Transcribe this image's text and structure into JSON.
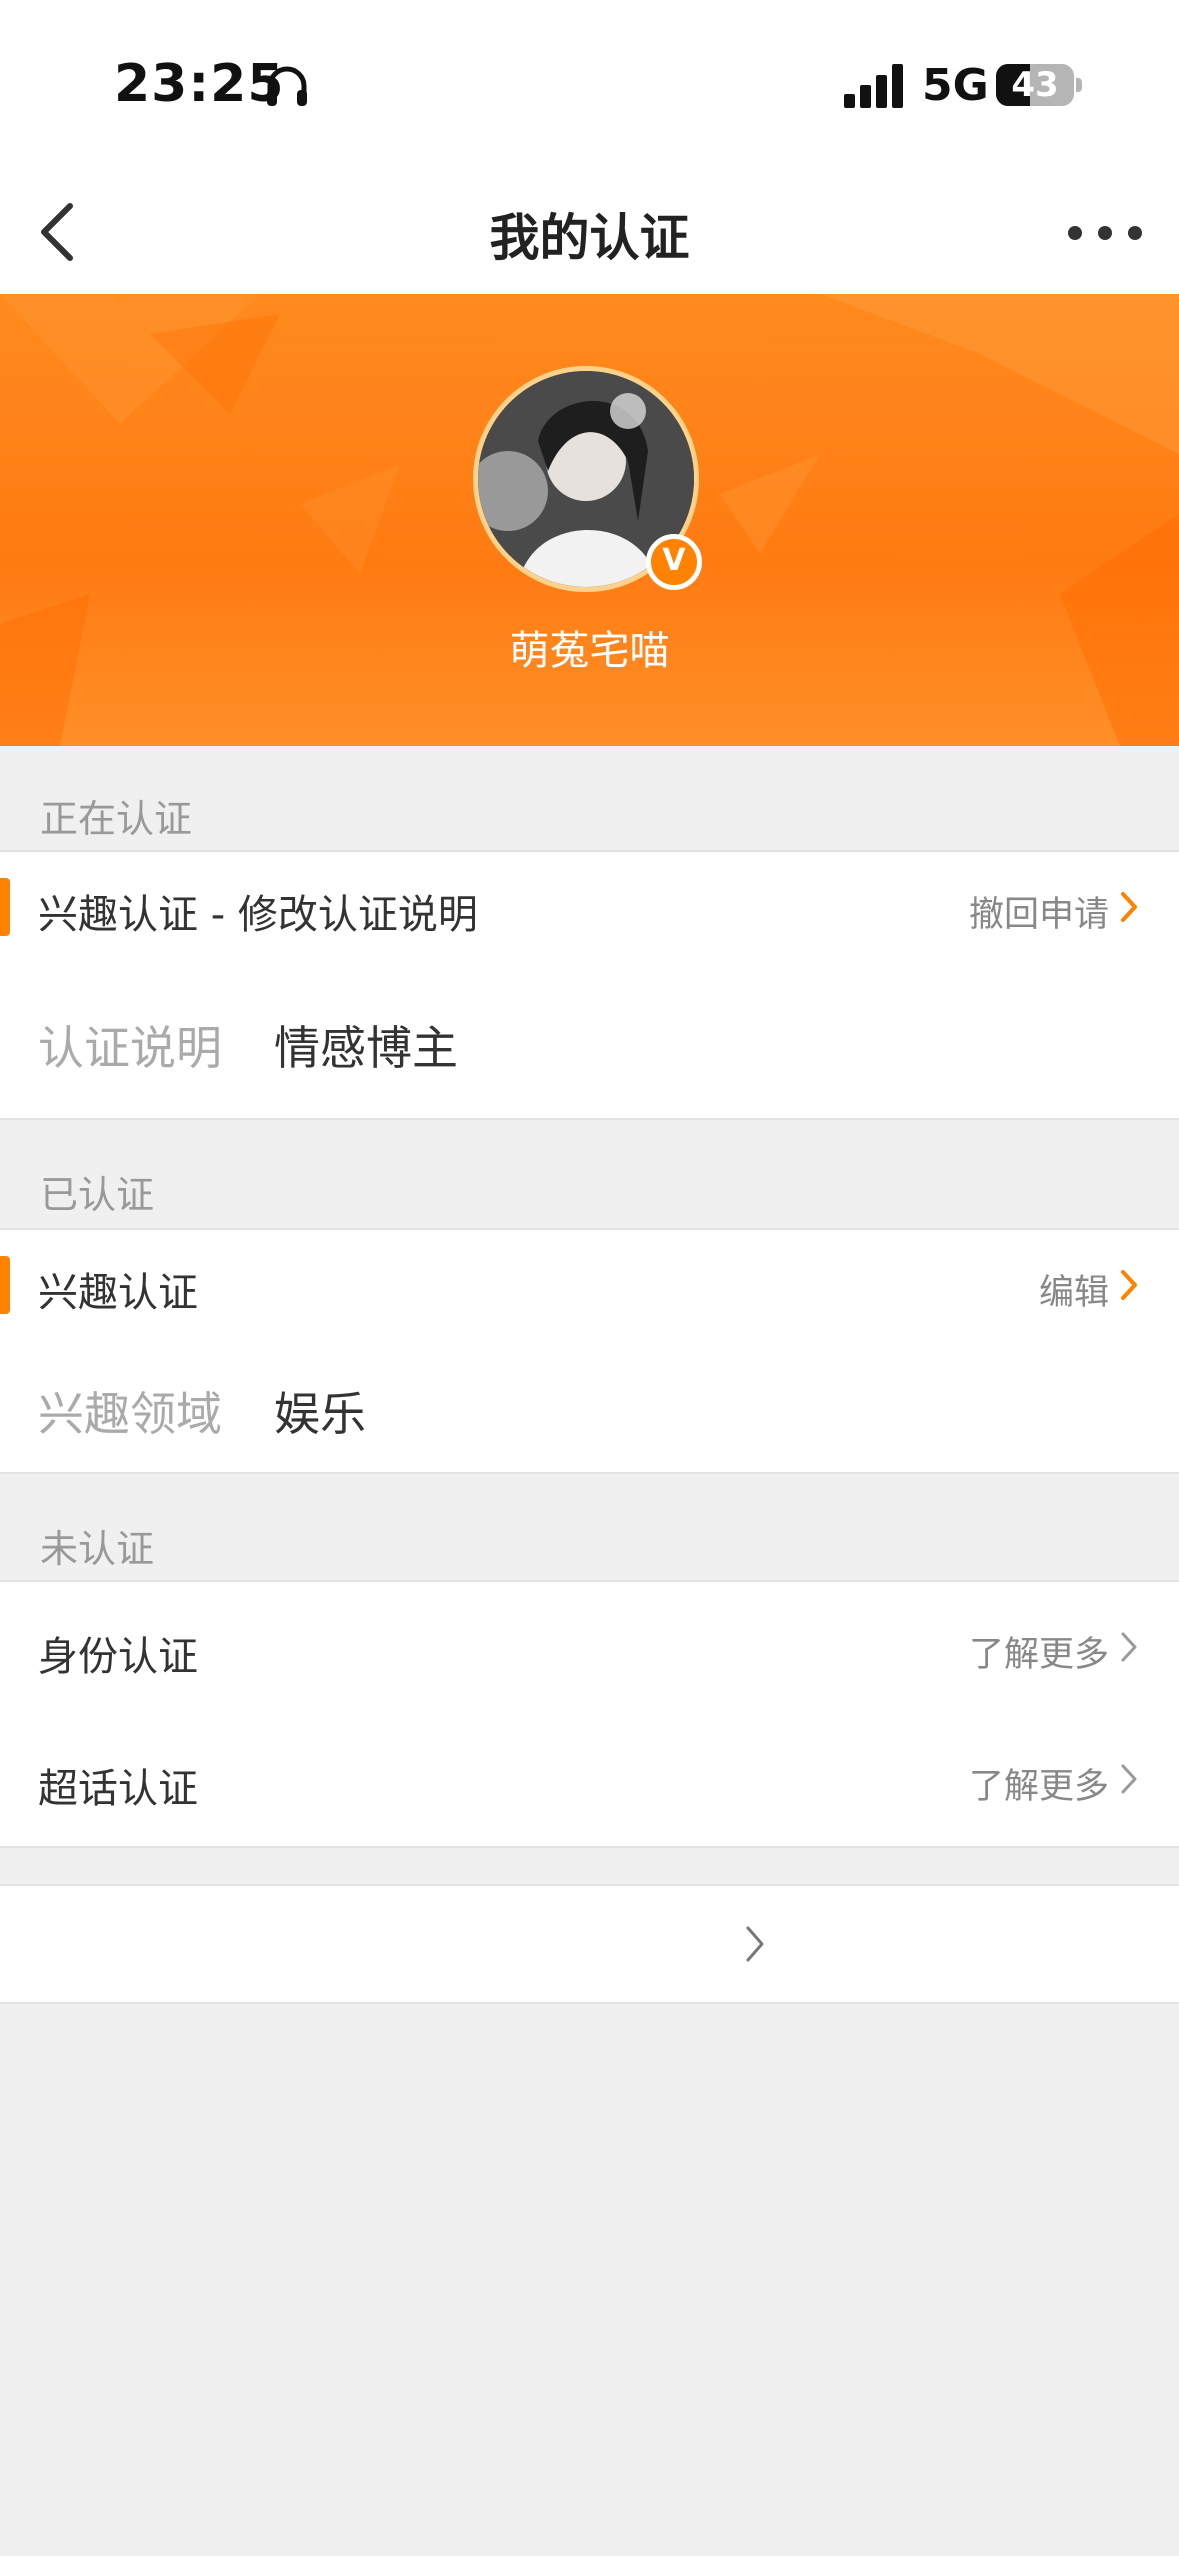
{
  "status_bar": {
    "time": "23:25",
    "network": "5G",
    "battery_percent": "43",
    "battery_level": 0.43,
    "icons": [
      "headphone-icon",
      "signal-icon",
      "battery-icon"
    ]
  },
  "nav": {
    "title": "我的认证",
    "back_icon": "chevron-left-icon",
    "more_icon": "more-dots-icon"
  },
  "profile": {
    "username": "萌菟宅喵",
    "badge": "V",
    "accent_color": "#ff8200"
  },
  "sections": {
    "pending": {
      "header": "正在认证",
      "item_title": "兴趣认证 - 修改认证说明",
      "item_action": "撤回申请",
      "info_label": "认证说明",
      "info_value": "情感博主"
    },
    "verified": {
      "header": "已认证",
      "item_title": "兴趣认证",
      "item_action": "编辑",
      "info_label": "兴趣领域",
      "info_value": "娱乐"
    },
    "unverified": {
      "header": "未认证",
      "items": [
        {
          "title": "身份认证",
          "action": "了解更多"
        },
        {
          "title": "超话认证",
          "action": "了解更多"
        }
      ]
    }
  },
  "footer": {
    "label": "",
    "chevron_icon": "chevron-right-icon"
  }
}
